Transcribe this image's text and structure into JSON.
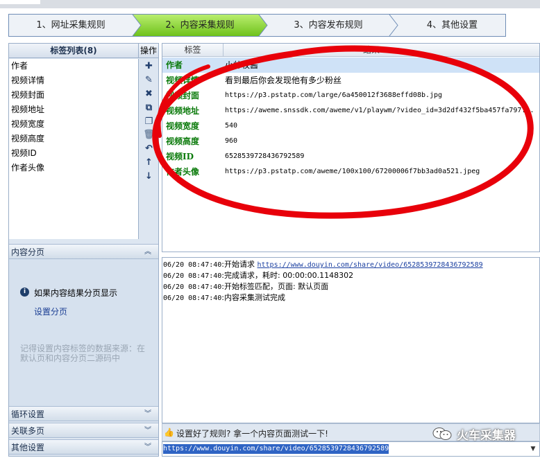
{
  "steps": [
    {
      "label": "1、网址采集规则",
      "active": false
    },
    {
      "label": "2、内容采集规则",
      "active": true
    },
    {
      "label": "3、内容发布规则",
      "active": false
    },
    {
      "label": "4、其他设置",
      "active": false
    }
  ],
  "left_panel": {
    "tag_list_title": "标签列表(8)",
    "ops_title": "操作",
    "tags": [
      "作者",
      "视频详情",
      "视频封面",
      "视频地址",
      "视频宽度",
      "视频高度",
      "视频ID",
      "作者头像"
    ],
    "op_icons": [
      "add-icon",
      "edit-icon",
      "delete-icon",
      "copy-icon",
      "paste-icon",
      "trash-icon",
      "undo-icon",
      "move-up-icon",
      "move-down-icon"
    ],
    "pager": {
      "title": "内容分页",
      "info_text": "如果内容结果分页显示",
      "link": "设置分页",
      "hint": "记得设置内容标签的数据来源：在默认页和内容分页二源码中"
    },
    "sections": [
      "循环设置",
      "关联多页",
      "其他设置"
    ]
  },
  "grid": {
    "col_tag": "标签",
    "col_result": "结果",
    "rows": [
      {
        "tag": "作者",
        "value": "小帅牧酱"
      },
      {
        "tag": "视频详情",
        "value": "看到最后你会发现他有多少粉丝"
      },
      {
        "tag": "视频封面",
        "value": "https://p3.pstatp.com/large/6a450012f3688effd08b.jpg"
      },
      {
        "tag": "视频地址",
        "value": "https://aweme.snssdk.com/aweme/v1/playwm/?video_id=3d2df432f5ba457fa797..."
      },
      {
        "tag": "视频宽度",
        "value": "540"
      },
      {
        "tag": "视频高度",
        "value": "960"
      },
      {
        "tag": "视频ID",
        "value": "6528539728436792589"
      },
      {
        "tag": "作者头像",
        "value": "https://p3.pstatp.com/aweme/100x100/67200006f7bb3ad0a521.jpeg"
      }
    ]
  },
  "log": [
    {
      "time": "06/20 08:47:40",
      "text": ":开始请求 ",
      "url": "https://www.douyin.com/share/video/6528539728436792589"
    },
    {
      "time": "06/20 08:47:40",
      "text": ":完成请求，耗时: 00:00:00.1148302",
      "url": ""
    },
    {
      "time": "06/20 08:47:40",
      "text": ":开始标签匹配，页面: 默认页面",
      "url": ""
    },
    {
      "time": "06/20 08:47:40",
      "text": ":内容采集测试完成",
      "url": ""
    }
  ],
  "tip": "设置好了规则? 拿一个内容页面测试一下!",
  "url_value": "https://www.douyin.com/share/video/6528539728436792589",
  "brand": "火车采集器",
  "colors": {
    "active_step": "#8cd63a",
    "annotation": "#e8000a",
    "tag_key": "#0a7a0a"
  }
}
